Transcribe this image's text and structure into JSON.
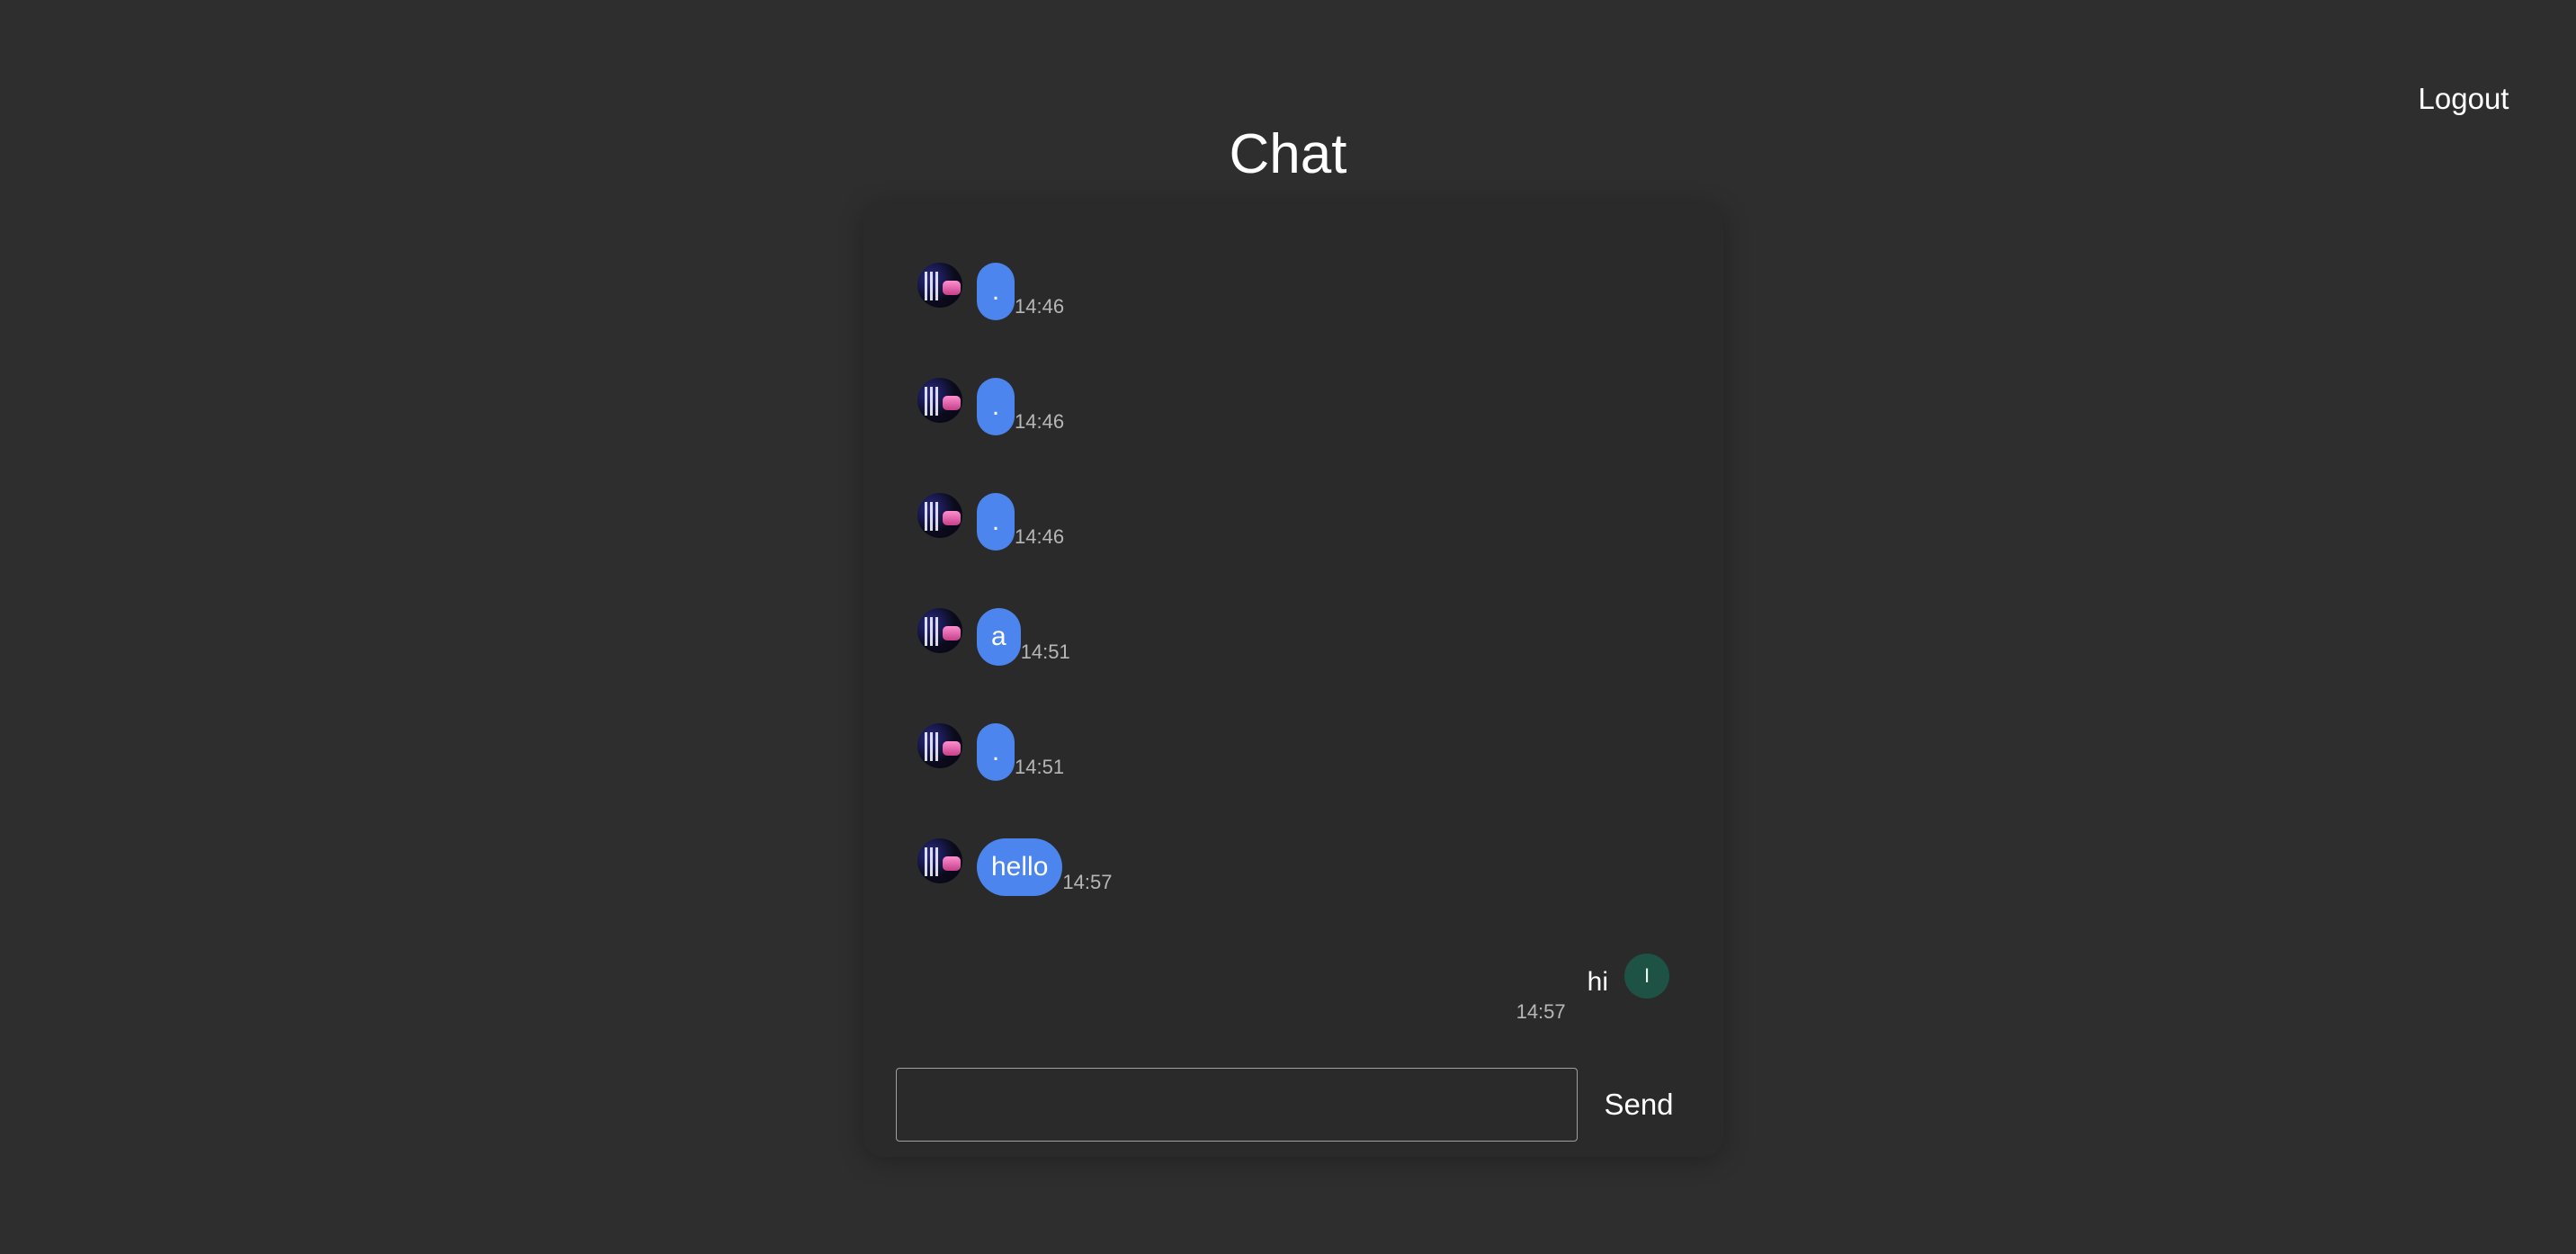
{
  "header": {
    "title": "Chat",
    "logout_label": "Logout"
  },
  "messages": [
    {
      "text": ".",
      "time": "14:46",
      "direction": "incoming",
      "avatar": "profile-photo"
    },
    {
      "text": ".",
      "time": "14:46",
      "direction": "incoming",
      "avatar": "profile-photo"
    },
    {
      "text": ".",
      "time": "14:46",
      "direction": "incoming",
      "avatar": "profile-photo"
    },
    {
      "text": "a",
      "time": "14:51",
      "direction": "incoming",
      "avatar": "profile-photo"
    },
    {
      "text": ".",
      "time": "14:51",
      "direction": "incoming",
      "avatar": "profile-photo"
    },
    {
      "text": "hello",
      "time": "14:57",
      "direction": "incoming",
      "avatar": "profile-photo"
    },
    {
      "text": "hi",
      "time": "14:57",
      "direction": "outgoing",
      "avatar_initial": "I"
    }
  ],
  "composer": {
    "input_value": "",
    "placeholder": "",
    "send_label": "Send"
  },
  "colors": {
    "background": "#2e2e2e",
    "panel": "#2a2a2a",
    "incoming_bubble": "#4c85ee",
    "outgoing_avatar": "#1e5244",
    "timestamp": "#b7b7b7"
  }
}
